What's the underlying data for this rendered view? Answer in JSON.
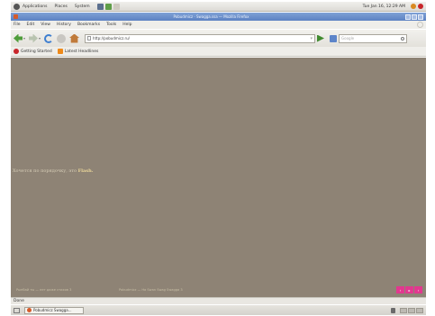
{
  "top_panel": {
    "menus": [
      "Applications",
      "Places",
      "System"
    ],
    "clock": "Tue Jan 16, 12:29 AM"
  },
  "window": {
    "title": "Pobudmicz · Swagga.ssa — Mozilla Firefox"
  },
  "menubar": {
    "items": [
      "File",
      "Edit",
      "View",
      "History",
      "Bookmarks",
      "Tools",
      "Help"
    ]
  },
  "navbar": {
    "url": "http://pobudmicz.ru/",
    "search_placeholder": "Google"
  },
  "bookmarks": {
    "items": [
      "Getting Started",
      "Latest Headlines"
    ]
  },
  "content": {
    "flash_message": "Хочется по порядочку, это",
    "flash_link": "Flash.",
    "footer_left": "Рынбай ты — лет даже стихов 3",
    "footer_right": "Pobudmicz — На Swan Swag Swagga 3",
    "colors": {
      "background": "#8e8375",
      "accent": "#e2388f"
    }
  },
  "status": {
    "text": "Done"
  },
  "taskbar": {
    "task_label": "Pobudmicz Swagga..."
  }
}
